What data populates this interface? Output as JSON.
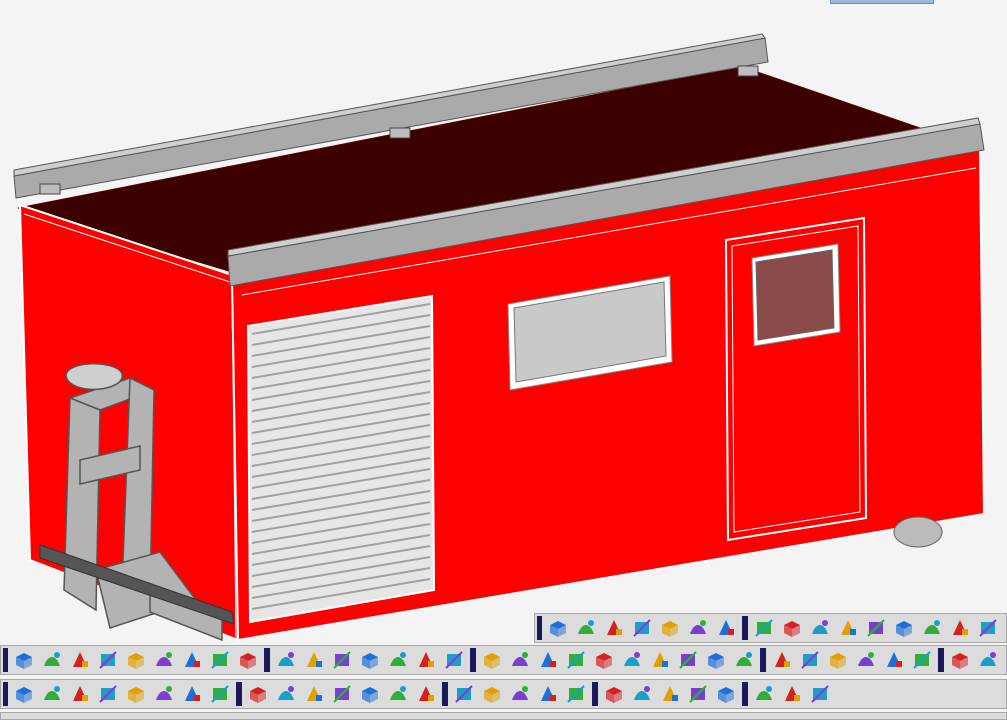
{
  "colors": {
    "background": "#f4f4f4",
    "body_red": "#ff0000",
    "roof": "#3d0000",
    "trim_gray": "#a9a9a9",
    "glass": "#c9c9c9",
    "door_glass": "#8a4b4b",
    "toolbar_bg": "#dcdcdc",
    "toolbar_grip": "#1a1a5a"
  },
  "toolbars": [
    {
      "name": "toolbar-surface-ops",
      "icons": [
        "extend-surface-icon",
        "offset-surface-icon",
        "project-surface-icon",
        "wrap-surface-icon",
        "user-surface-icon",
        "cube-view-icon",
        "align-icon"
      ]
    },
    {
      "name": "toolbar-freeform",
      "icons": [
        "freeform-arrow-icon",
        "sweep-surface-icon",
        "blend-surface-icon",
        "patch-surface-icon",
        "loft-surface-icon",
        "fill-surface-icon",
        "curvature-icon",
        "trim-surface-icon",
        "offset-shell-icon"
      ]
    },
    {
      "name": "toolbar-solid-ops",
      "icons": [
        "extrude-icon",
        "revolve-icon",
        "sweep-icon",
        "draft-icon",
        "pipe-icon",
        "rib-icon",
        "bend-icon",
        "taper-icon",
        "y-split-icon"
      ]
    },
    {
      "name": "toolbar-primitives",
      "icons": [
        "box-icon",
        "shell-icon",
        "hole-icon",
        "boss-icon",
        "pocket-icon",
        "chamfer-box-icon",
        "fillet-icon"
      ]
    },
    {
      "name": "toolbar-modify",
      "icons": [
        "mirror-icon",
        "pattern-icon",
        "section-icon",
        "shell-body-icon",
        "split-body-icon",
        "combine-icon",
        "subtract-icon",
        "intersect-icon",
        "scale-body-icon",
        "move-body-icon"
      ]
    },
    {
      "name": "toolbar-wireframe",
      "icons": [
        "corner-line-icon",
        "arc-line-icon",
        "fillet-line-icon",
        "step-line-icon",
        "chamfer-line-icon",
        "offset-line-icon"
      ]
    },
    {
      "name": "toolbar-lines",
      "icons": [
        "line-icon",
        "polyline-icon",
        "slash-line-icon"
      ]
    },
    {
      "name": "toolbar-primitive-shapes",
      "icons": [
        "sphere-icon",
        "cylinder-icon",
        "cone-icon",
        "eye-view-icon",
        "box-solid-icon",
        "pyramid-icon",
        "ellipsoid-icon",
        "wedge-icon"
      ]
    },
    {
      "name": "toolbar-boolean",
      "icons": [
        "cut-extrude-icon",
        "array-icon",
        "union-icon",
        "subtract-solid-icon",
        "split-solid-icon",
        "thicken-icon",
        "dome-icon"
      ]
    },
    {
      "name": "toolbar-face-ops",
      "icons": [
        "face-offset-icon",
        "face-move-icon",
        "face-replace-icon",
        "face-draft-icon",
        "face-delete-icon"
      ]
    },
    {
      "name": "toolbar-analysis",
      "icons": [
        "continuity-icon",
        "mesh-icon",
        "zebra-icon",
        "grid-icon",
        "normal-icon"
      ]
    },
    {
      "name": "toolbar-curves",
      "icons": [
        "curve-on-surface-icon",
        "silhouette-icon",
        "isoline-icon"
      ]
    }
  ]
}
